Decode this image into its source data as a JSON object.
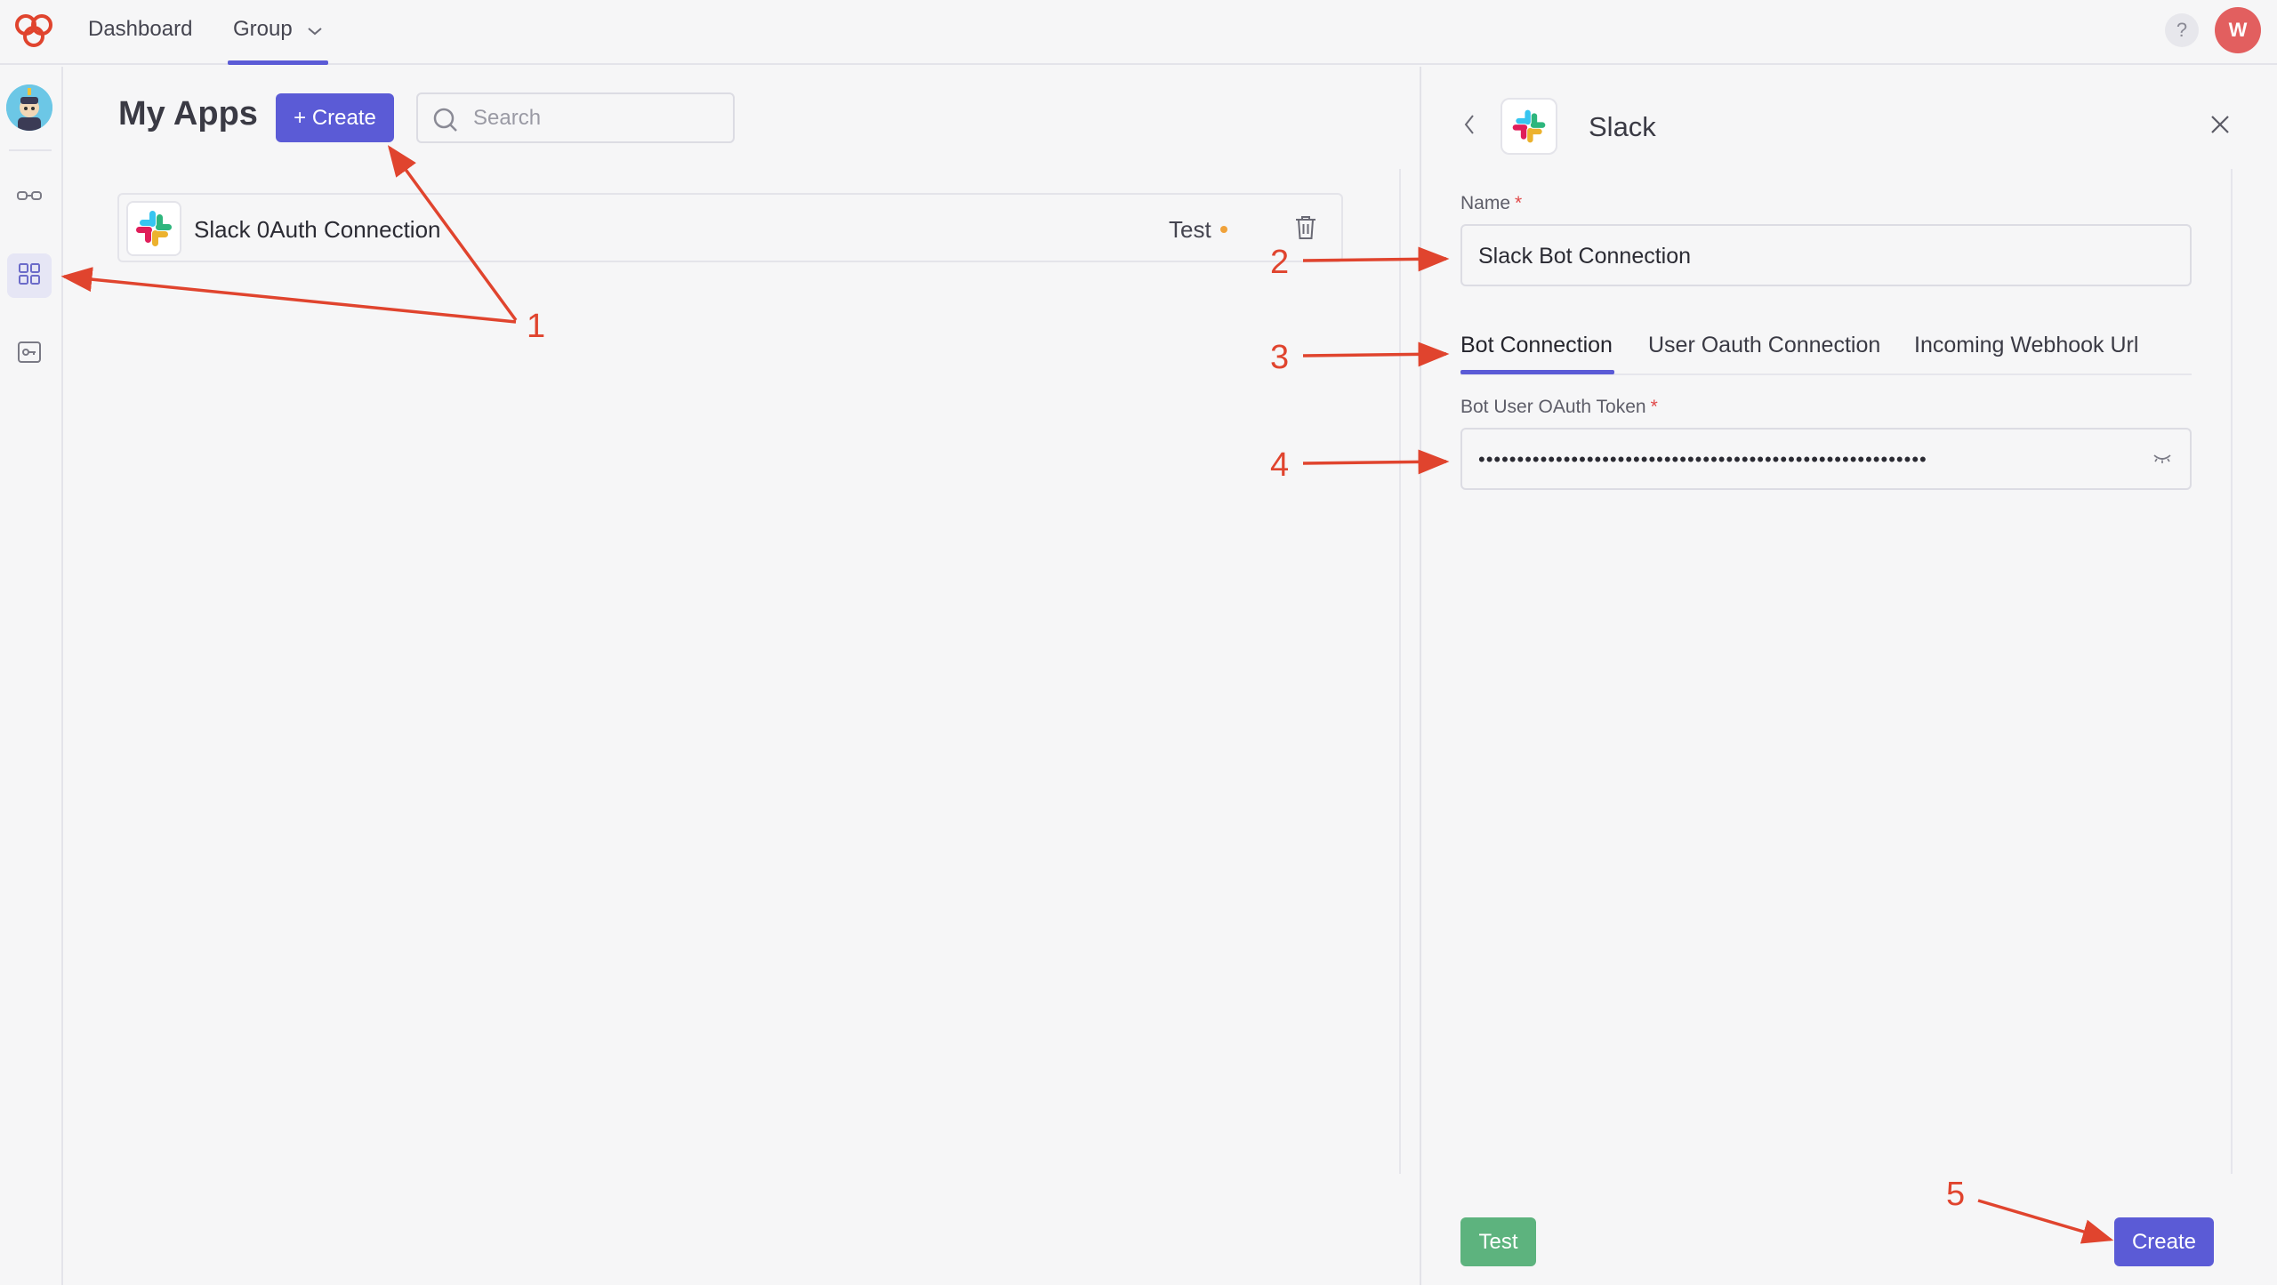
{
  "topbar": {
    "nav": {
      "dashboard": "Dashboard",
      "group": "Group"
    },
    "help": "?",
    "user_initial": "W"
  },
  "main": {
    "title": "My Apps",
    "create_label": "+ Create",
    "search_placeholder": "Search",
    "apps": [
      {
        "name": "Slack 0Auth Connection",
        "env": "Test"
      }
    ]
  },
  "panel": {
    "title": "Slack",
    "name_label": "Name",
    "name_value": "Slack Bot Connection",
    "required_mark": "*",
    "tabs": [
      "Bot Connection",
      "User Oauth Connection",
      "Incoming Webhook Url"
    ],
    "active_tab": "Bot Connection",
    "token_label": "Bot User OAuth Token",
    "token_value": "••••••••••••••••••••••••••••••••••••••••••••••••••••••••••",
    "test_label": "Test",
    "create_label": "Create"
  },
  "annotations": [
    "1",
    "2",
    "3",
    "4",
    "5"
  ],
  "colors": {
    "accent": "#5b5bd6",
    "success": "#5db37e",
    "annotation": "#e0442e",
    "avatar": "#e25f5f",
    "status_dot": "#f0a23a"
  }
}
